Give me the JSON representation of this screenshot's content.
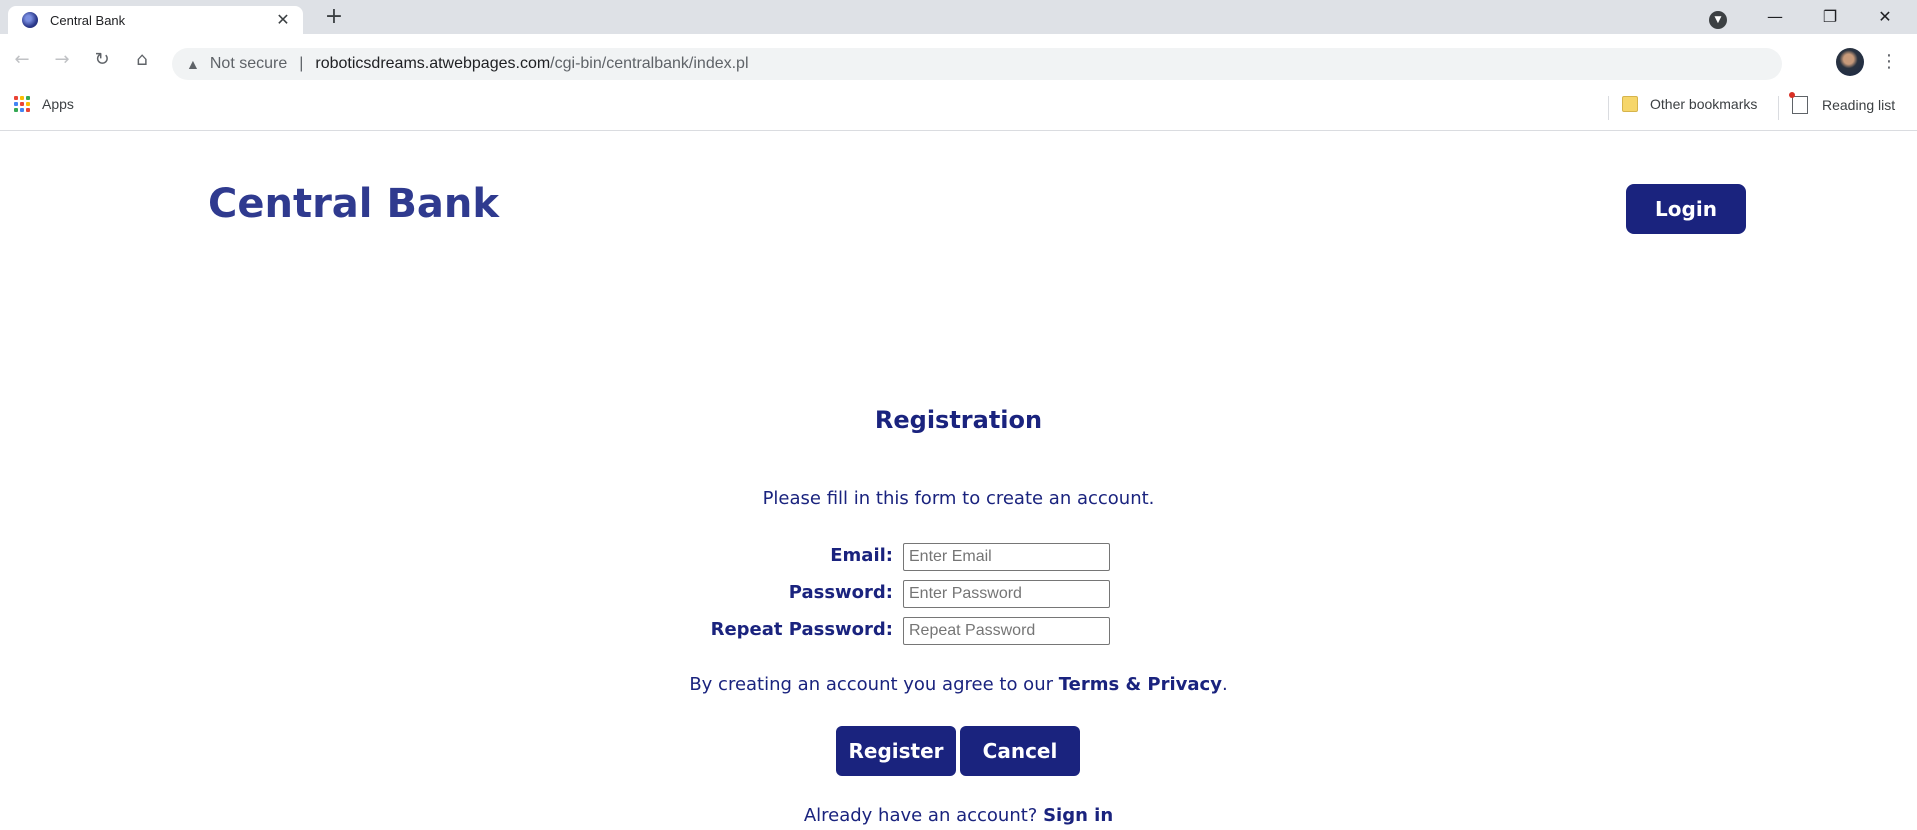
{
  "browser": {
    "tab_title": "Central Bank",
    "url_warning": "Not secure",
    "url_separator": "|",
    "url_host": "roboticsdreams.atwebpages.com",
    "url_path": "/cgi-bin/centralbank/index.pl",
    "bookmarks": {
      "apps_label": "Apps",
      "other_bookmarks_label": "Other bookmarks",
      "reading_list_label": "Reading list"
    }
  },
  "header": {
    "brand": "Central Bank",
    "login_label": "Login"
  },
  "registration": {
    "title": "Registration",
    "description": "Please fill in this form to create an account.",
    "fields": [
      {
        "label": "Email:",
        "placeholder": "Enter Email",
        "value": ""
      },
      {
        "label": "Password:",
        "placeholder": "Enter Password",
        "value": ""
      },
      {
        "label": "Repeat Password:",
        "placeholder": "Repeat Password",
        "value": ""
      }
    ],
    "terms_text": "By creating an account you agree to our ",
    "terms_link": "Terms & Privacy",
    "terms_end": ".",
    "register_label": "Register",
    "cancel_label": "Cancel",
    "signin_text": "Already have an account? ",
    "signin_link": "Sign in"
  },
  "colors": {
    "primary": "#1a237e",
    "brand": "#2f3a8f"
  }
}
